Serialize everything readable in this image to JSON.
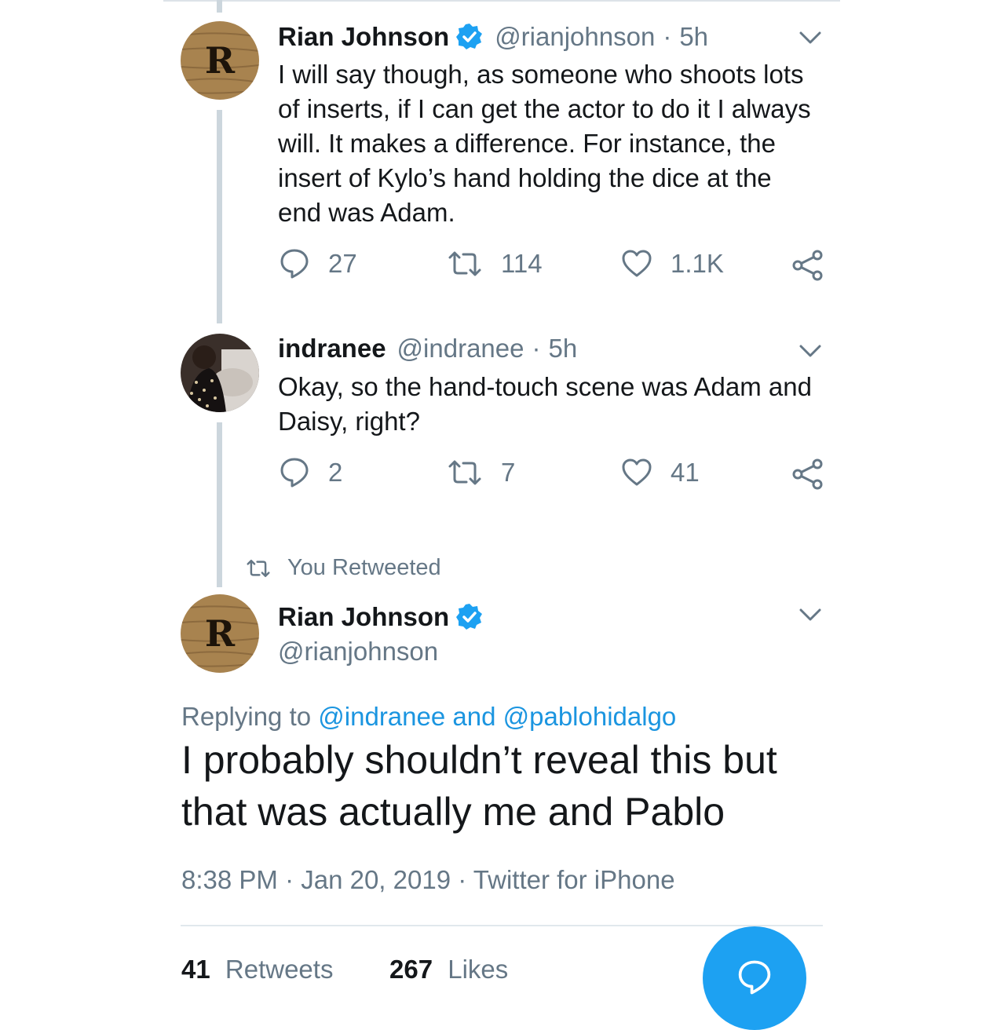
{
  "tweets": [
    {
      "name": "Rian Johnson",
      "handle": "@rianjohnson",
      "dot": "·",
      "time": "5h",
      "lines": [
        "I will say though, as someone who shoots lots",
        "of inserts, if I can get the actor to do it I always",
        "will. It makes a difference. For instance, the",
        "insert of Kylo’s hand holding the dice at the",
        "end was Adam."
      ],
      "replies": "27",
      "retweets": "114",
      "likes": "1.1K"
    },
    {
      "name": "indranee",
      "handle": "@indranee",
      "dot": "·",
      "time": "5h",
      "lines": [
        "Okay, so the hand-touch scene was Adam and",
        "Daisy, right?"
      ],
      "replies": "2",
      "retweets": "7",
      "likes": "41"
    }
  ],
  "retweet_notice": "You Retweeted",
  "main_tweet": {
    "name": "Rian Johnson",
    "handle": "@rianjohnson",
    "replying_prefix": "Replying to",
    "replying_to": "@indranee and @pablohidalgo",
    "lines": [
      "I probably shouldn’t reveal this but",
      "that was actually me and Pablo"
    ],
    "timestamp": "8:38 PM · Jan 20, 2019 · Twitter for iPhone",
    "retweets_count": "41",
    "retweets_label": "Retweets",
    "likes_count": "267",
    "likes_label": "Likes"
  },
  "avatar_letter": "R",
  "colors": {
    "accent": "#1da1f2",
    "link": "#1b95e0",
    "muted": "#657786",
    "text": "#14171a"
  },
  "icons": [
    "verified-badge-icon",
    "chevron-down-icon",
    "reply-icon",
    "retweet-icon",
    "like-icon",
    "share-icon",
    "compose-reply-icon"
  ]
}
